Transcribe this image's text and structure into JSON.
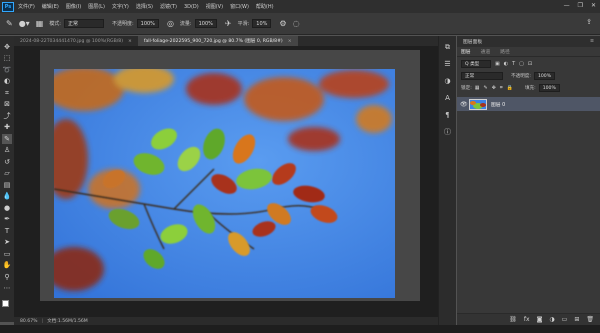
{
  "app": {
    "logo": "Ps"
  },
  "menu": [
    "文件(F)",
    "编辑(E)",
    "图像(I)",
    "图层(L)",
    "文字(Y)",
    "选择(S)",
    "滤镜(T)",
    "3D(D)",
    "视图(V)",
    "窗口(W)",
    "帮助(H)"
  ],
  "window_controls": [
    "—",
    "❐",
    "✕"
  ],
  "options": {
    "mode_label": "模式:",
    "mode_value": "正常",
    "opacity_label": "不透明度:",
    "opacity_value": "100%",
    "flow_label": "流量:",
    "flow_value": "100%",
    "smooth_label": "平滑:",
    "smooth_value": "10%"
  },
  "tabs": [
    {
      "label": "2024-08-22T034441470.jpg @ 100%(RGB/8)",
      "active": false
    },
    {
      "label": "fall-foliage-2022595_900_720.jpg @ 80.7% (图层 0, RGB/8#)",
      "active": true
    }
  ],
  "status": {
    "zoom": "80.67%",
    "doc": "文档:1.56M/1.56M"
  },
  "panel": {
    "header": "图层面板",
    "tabs": [
      "图层",
      "通道",
      "路径"
    ],
    "kind_label": "Q 类型",
    "blend_value": "正常",
    "opacity_label": "不透明度:",
    "opacity_value": "100%",
    "lock_label": "锁定:",
    "fill_label": "填充:",
    "fill_value": "100%",
    "layer_name": "图层 0"
  },
  "colors": {
    "sky": "#3b82e6",
    "leaf_green": "#7cc43a",
    "leaf_red": "#a8331c",
    "leaf_orange": "#d8761e"
  }
}
